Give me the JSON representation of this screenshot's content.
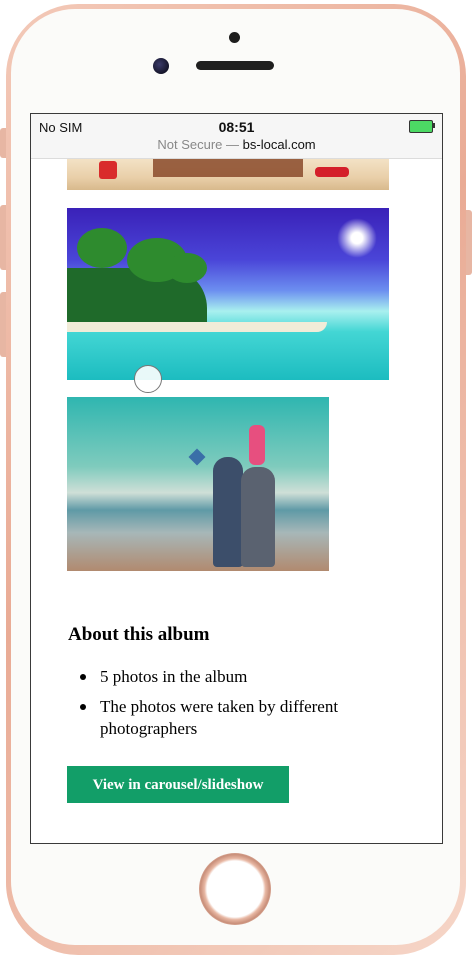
{
  "device": {
    "type": "iPhone",
    "frame_color": "#efb9a5"
  },
  "status_bar": {
    "carrier": "No SIM",
    "time": "08:51",
    "battery_icon": "battery-charging-icon"
  },
  "address_bar": {
    "security_label": "Not Secure —",
    "domain": "bs-local.com"
  },
  "album": {
    "photos": [
      {
        "name": "beach-chairs-photo"
      },
      {
        "name": "tropical-island-photo"
      },
      {
        "name": "family-beach-photo"
      }
    ]
  },
  "about": {
    "title": "About this album",
    "items": [
      "5 photos in the album",
      "The photos were taken by different photographers"
    ]
  },
  "actions": {
    "carousel_label": "View in carousel/slideshow",
    "carousel_color": "#129e68"
  }
}
